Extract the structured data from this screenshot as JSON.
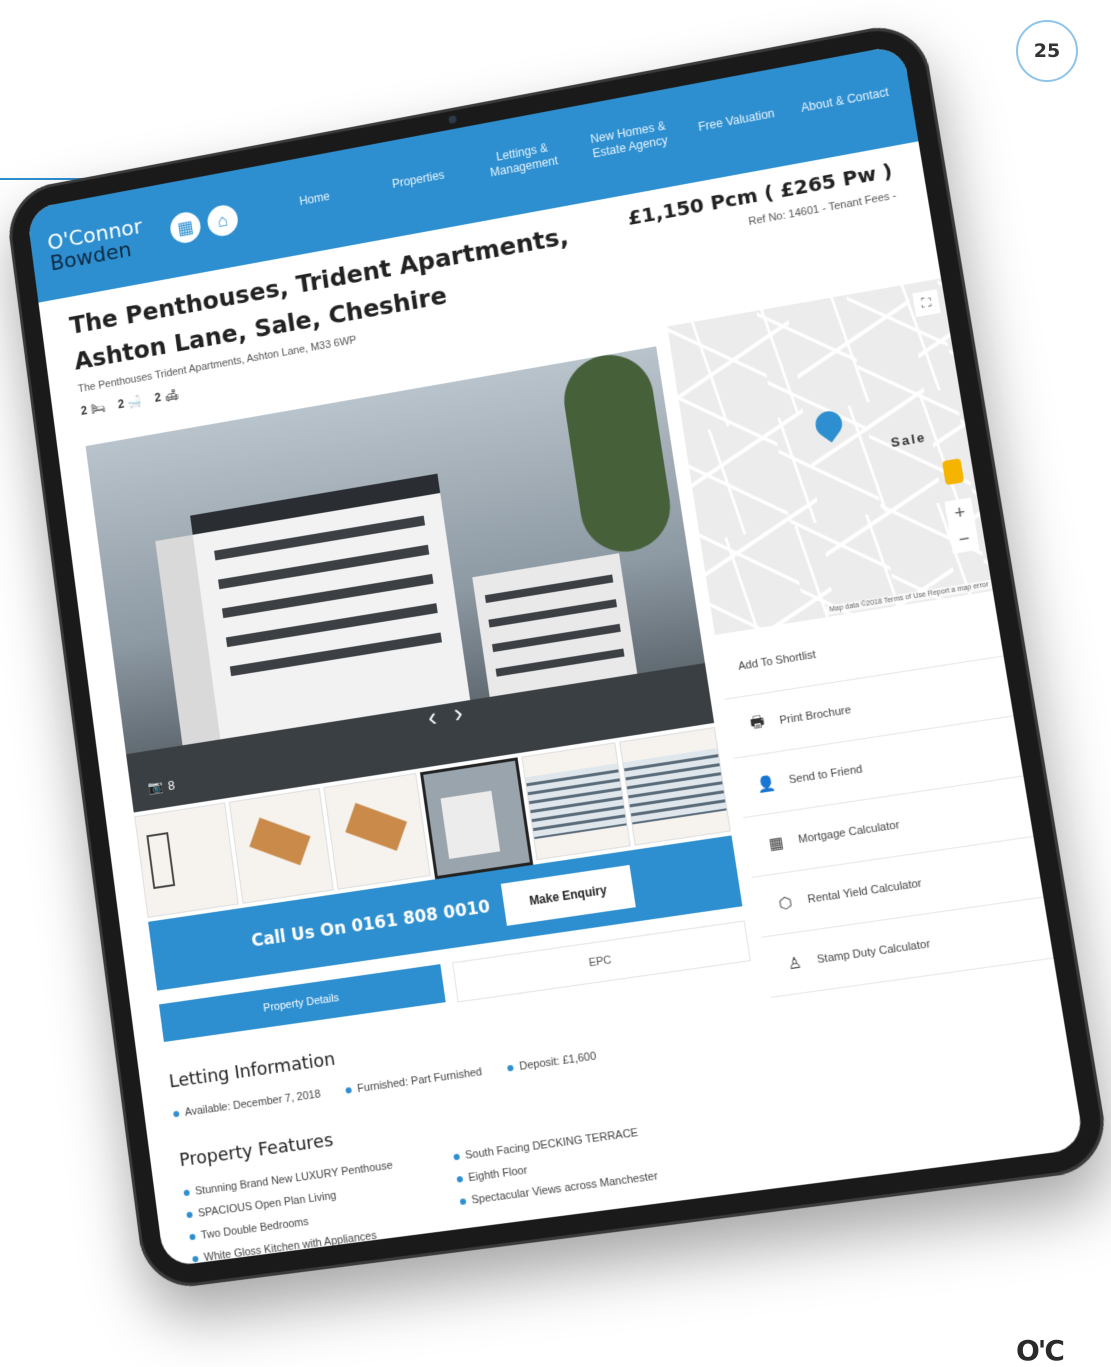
{
  "page_number": "25",
  "header": {
    "logo_line1": "O'Connor",
    "logo_line2": "Bowden",
    "nav": [
      "Home",
      "Properties",
      "Lettings & Management",
      "New Homes & Estate Agency",
      "Free Valuation",
      "About & Contact"
    ]
  },
  "listing": {
    "title": "The Penthouses, Trident Apartments, Ashton Lane, Sale, Cheshire",
    "address": "The Penthouses Trident Apartments, Ashton Lane, M33 6WP",
    "price": "£1,150 Pcm ( £265 Pw )",
    "ref": "Ref No: 14601 - Tenant Fees -",
    "beds": "2",
    "baths": "2",
    "receptions": "2",
    "photo_count": "8"
  },
  "map": {
    "town_label": "Sale",
    "attribution": "Map data ©2018  Terms of Use  Report a map error"
  },
  "actions": [
    "Add To Shortlist",
    "Print Brochure",
    "Send to Friend",
    "Mortgage Calculator",
    "Rental Yield Calculator",
    "Stamp Duty Calculator"
  ],
  "cta": {
    "call_text": "Call Us On  0161 808 0010",
    "enquiry_label": "Make Enquiry"
  },
  "tabs": [
    "Property Details",
    "EPC"
  ],
  "letting": {
    "heading": "Letting Information",
    "items": [
      "Available: December 7, 2018",
      "Furnished: Part Furnished",
      "Deposit: £1,600"
    ]
  },
  "features": {
    "heading": "Property Features",
    "items": [
      "Stunning Brand New LUXURY Penthouse",
      "South Facing DECKING TERRACE",
      "SPACIOUS Open Plan Living",
      "Eighth Floor",
      "Two Double Bedrooms",
      "Spectacular Views across Manchester",
      "White Gloss Kitchen with Appliances"
    ]
  },
  "corner_logo": "O'C"
}
